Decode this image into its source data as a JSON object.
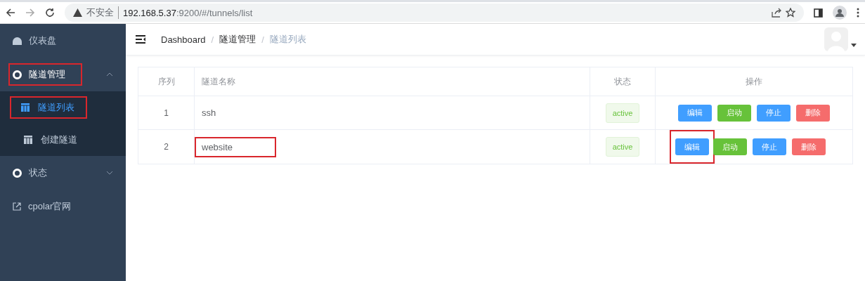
{
  "browser": {
    "security": "不安全",
    "url_host": "192.168.5.37",
    "url_rest": ":9200/#/tunnels/list"
  },
  "sidebar": {
    "items": [
      {
        "label": "仪表盘",
        "kind": "dashboard"
      },
      {
        "label": "隧道管理",
        "kind": "group",
        "expanded": true,
        "highlighted": true,
        "children": [
          {
            "label": "隧道列表",
            "selected": true,
            "highlighted": true
          },
          {
            "label": "创建隧道",
            "selected": false
          }
        ]
      },
      {
        "label": "状态",
        "kind": "group",
        "expanded": false
      },
      {
        "label": "cpolar官网",
        "kind": "link"
      }
    ]
  },
  "breadcrumb": [
    {
      "label": "Dashboard",
      "current": false
    },
    {
      "separator": "/",
      "label": "隧道管理",
      "current": false
    },
    {
      "separator": "/",
      "label": "隧道列表",
      "current": true
    }
  ],
  "table": {
    "columns": [
      "序列",
      "隧道名称",
      "状态",
      "操作"
    ],
    "rows": [
      {
        "index": "1",
        "name": "ssh",
        "status": "active",
        "actions": [
          {
            "label": "编辑",
            "kind": "primary"
          },
          {
            "label": "启动",
            "kind": "success"
          },
          {
            "label": "停止",
            "kind": "primary"
          },
          {
            "label": "删除",
            "kind": "danger"
          }
        ]
      },
      {
        "index": "2",
        "name": "website",
        "name_highlighted": true,
        "status": "active",
        "actions": [
          {
            "label": "编辑",
            "kind": "primary",
            "highlighted": true
          },
          {
            "label": "启动",
            "kind": "success"
          },
          {
            "label": "停止",
            "kind": "primary"
          },
          {
            "label": "删除",
            "kind": "danger"
          }
        ]
      }
    ]
  }
}
